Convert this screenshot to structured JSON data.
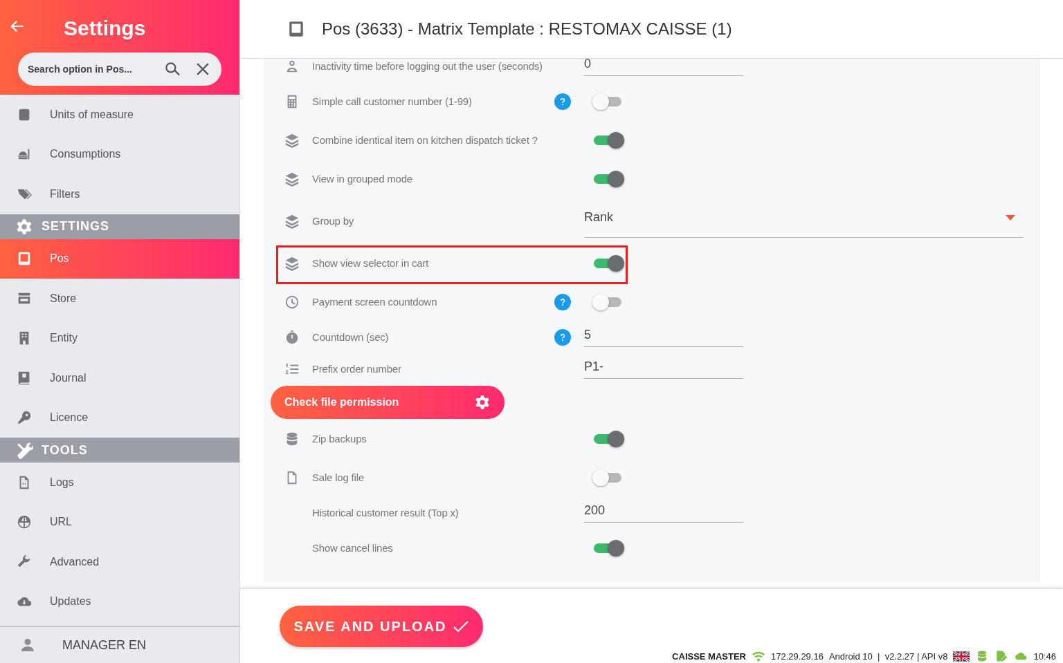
{
  "sidebar": {
    "title": "Settings",
    "search": {
      "placeholder": "Search option in Pos..."
    },
    "groups": [
      {
        "items": [
          {
            "label": "Units of measure",
            "selected": false
          },
          {
            "label": "Consumptions",
            "selected": false
          },
          {
            "label": "Filters",
            "selected": false
          }
        ]
      },
      {
        "header": "SETTINGS",
        "items": [
          {
            "label": "Pos",
            "selected": true
          },
          {
            "label": "Store",
            "selected": false
          },
          {
            "label": "Entity",
            "selected": false
          },
          {
            "label": "Journal",
            "selected": false
          },
          {
            "label": "Licence",
            "selected": false
          }
        ]
      },
      {
        "header": "TOOLS",
        "items": [
          {
            "label": "Logs",
            "selected": false
          },
          {
            "label": "URL",
            "selected": false
          },
          {
            "label": "Advanced",
            "selected": false
          },
          {
            "label": "Updates",
            "selected": false
          }
        ]
      }
    ],
    "user": "MANAGER EN"
  },
  "page": {
    "title": "Pos (3633) - Matrix Template : RESTOMAX CAISSE (1)",
    "settings": [
      {
        "kind": "field",
        "label": "Inactivity time before logging out the user (seconds)",
        "value": "0",
        "help": false,
        "highlighted": false
      },
      {
        "kind": "toggle",
        "label": "Simple call customer number (1-99)",
        "on": false,
        "help": true,
        "highlighted": false
      },
      {
        "kind": "toggle",
        "label": "Combine identical item on kitchen dispatch ticket ?",
        "on": true,
        "help": false,
        "highlighted": false
      },
      {
        "kind": "toggle",
        "label": "View in grouped mode",
        "on": true,
        "help": false,
        "highlighted": false
      },
      {
        "kind": "select",
        "label": "Group by",
        "value": "Rank",
        "help": false,
        "highlighted": false
      },
      {
        "kind": "toggle",
        "label": "Show view selector in cart",
        "on": true,
        "help": false,
        "highlighted": true
      },
      {
        "kind": "toggle",
        "label": "Payment screen countdown",
        "on": false,
        "help": true,
        "highlighted": false
      },
      {
        "kind": "field",
        "label": "Countdown (sec)",
        "value": "5",
        "help": true,
        "highlighted": false
      },
      {
        "kind": "field",
        "label": "Prefix order number",
        "value": "P1-",
        "help": false,
        "highlighted": false
      },
      {
        "kind": "button",
        "label": "Check file permission",
        "help": false,
        "highlighted": false
      },
      {
        "kind": "toggle",
        "label": "Zip backups",
        "on": true,
        "help": false,
        "highlighted": false
      },
      {
        "kind": "toggle",
        "label": "Sale log file",
        "on": false,
        "help": false,
        "highlighted": false
      },
      {
        "kind": "field",
        "label": "Historical customer result (Top x)",
        "value": "200",
        "help": false,
        "highlighted": false
      },
      {
        "kind": "toggle",
        "label": "Show cancel lines",
        "on": true,
        "help": false,
        "highlighted": false
      }
    ],
    "save_button": "SAVE AND UPLOAD"
  },
  "status_bar": {
    "app": "CAISSE MASTER",
    "ip": "172.29.29.16",
    "version": "Android 10  |  v2.2.27 | API v8",
    "time": "10:46"
  }
}
